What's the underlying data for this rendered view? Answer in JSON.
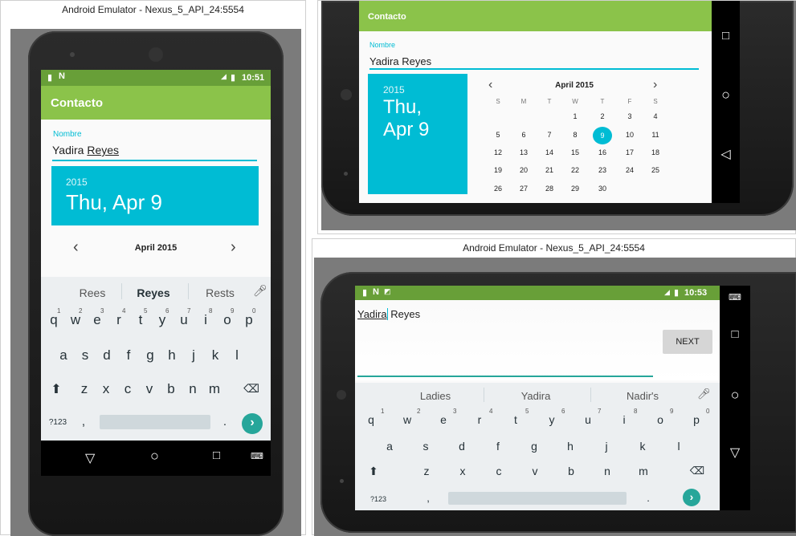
{
  "left_window": {
    "title": "Android Emulator - Nexus_5_API_24:5554",
    "status_time": "10:51",
    "app_title": "Contacto",
    "name_label": "Nombre",
    "name_first": "Yadira ",
    "name_last": "Reyes",
    "date_year": "2015",
    "date_text": "Thu, Apr 9",
    "month_label": "April 2015",
    "prev": "‹",
    "next": "›",
    "suggestions": [
      "Rees",
      "Reyes",
      "Rests"
    ],
    "row1": [
      "q",
      "w",
      "e",
      "r",
      "t",
      "y",
      "u",
      "i",
      "o",
      "p"
    ],
    "row1_sup": [
      "1",
      "2",
      "3",
      "4",
      "5",
      "6",
      "7",
      "8",
      "9",
      "0"
    ],
    "row2": [
      "a",
      "s",
      "d",
      "f",
      "g",
      "h",
      "j",
      "k",
      "l"
    ],
    "row3": [
      "z",
      "x",
      "c",
      "v",
      "b",
      "n",
      "m"
    ],
    "sym_key": "?123",
    "comma": ",",
    "period": "."
  },
  "top_right_window": {
    "app_title": "Contacto",
    "name_label": "Nombre",
    "name_value": "Yadira Reyes",
    "date_year": "2015",
    "date_day": "Thu,",
    "date_md": "Apr 9",
    "month_label": "April 2015",
    "prev": "‹",
    "next": "›",
    "weekdays": [
      "S",
      "M",
      "T",
      "W",
      "T",
      "F",
      "S"
    ],
    "weeks": [
      [
        "",
        "",
        "",
        "1",
        "2",
        "3",
        "4"
      ],
      [
        "5",
        "6",
        "7",
        "8",
        "9",
        "10",
        "11"
      ],
      [
        "12",
        "13",
        "14",
        "15",
        "16",
        "17",
        "18"
      ],
      [
        "19",
        "20",
        "21",
        "22",
        "23",
        "24",
        "25"
      ],
      [
        "26",
        "27",
        "28",
        "29",
        "30",
        "",
        ""
      ]
    ],
    "selected_day": "9"
  },
  "bottom_right_window": {
    "title": "Android Emulator - Nexus_5_API_24:5554",
    "status_time": "10:53",
    "text_first": "Yadira",
    "text_rest": " Reyes",
    "next_button": "NEXT",
    "suggestions": [
      "Ladies",
      "Yadira",
      "Nadir's"
    ],
    "row1": [
      "q",
      "w",
      "e",
      "r",
      "t",
      "y",
      "u",
      "i",
      "o",
      "p"
    ],
    "row1_sup": [
      "1",
      "2",
      "3",
      "4",
      "5",
      "6",
      "7",
      "8",
      "9",
      "0"
    ],
    "row2": [
      "a",
      "s",
      "d",
      "f",
      "g",
      "h",
      "j",
      "k",
      "l"
    ],
    "row3": [
      "z",
      "x",
      "c",
      "v",
      "b",
      "n",
      "m"
    ],
    "sym_key": "?123",
    "comma": ",",
    "period": "."
  },
  "colors": {
    "toolbar": "#8bc34a",
    "status": "#689f38",
    "accent": "#00bcd4",
    "enter_key": "#26a69a"
  }
}
